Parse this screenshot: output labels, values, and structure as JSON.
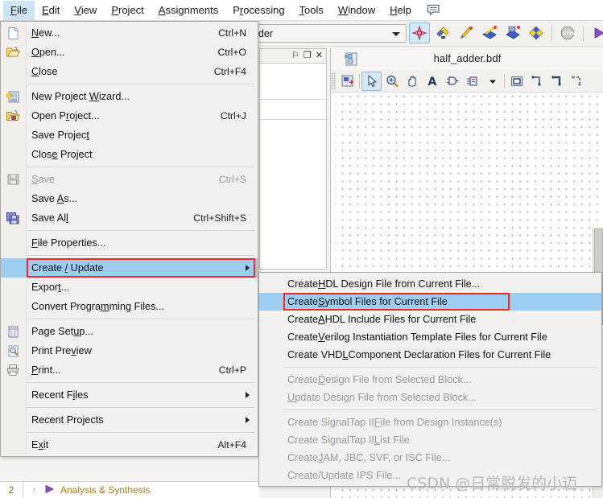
{
  "menubar": {
    "items": [
      {
        "label": "File",
        "mnemonic": "F",
        "active": true
      },
      {
        "label": "Edit",
        "mnemonic": "E",
        "active": false
      },
      {
        "label": "View",
        "mnemonic": "V",
        "active": false
      },
      {
        "label": "Project",
        "mnemonic": "P",
        "active": false
      },
      {
        "label": "Assignments",
        "mnemonic": "A",
        "active": false
      },
      {
        "label": "Processing",
        "mnemonic": "r",
        "active": false
      },
      {
        "label": "Tools",
        "mnemonic": "T",
        "active": false
      },
      {
        "label": "Window",
        "mnemonic": "W",
        "active": false
      },
      {
        "label": "Help",
        "mnemonic": "H",
        "active": false
      }
    ],
    "comment_icon": "comment-icon"
  },
  "toolbar": {
    "combo_value": "adder",
    "buttons": [
      {
        "name": "compilation-report-icon",
        "selected": true
      },
      {
        "name": "analysis-elaboration-icon",
        "selected": false
      },
      {
        "name": "analysis-synthesis-icon",
        "selected": false
      },
      {
        "name": "start-compilation-icon",
        "selected": false
      },
      {
        "name": "start-compilation-timing-icon",
        "selected": false
      },
      {
        "name": "programmer-icon",
        "selected": false
      },
      {
        "name": "stop-icon",
        "selected": false
      },
      {
        "name": "start-icon",
        "selected": false
      }
    ]
  },
  "left_dock": {
    "pin_glyph": "⚐",
    "restore_glyph": "❐",
    "close_glyph": "✕"
  },
  "editor": {
    "tab_title": "half_adder.bdf",
    "tab_icon": "bdf-file-icon",
    "tools": [
      {
        "name": "new-symbol-icon",
        "selected": false
      },
      {
        "name": "selection-tool-icon",
        "selected": true
      },
      {
        "name": "zoom-tool-icon",
        "selected": false
      },
      {
        "name": "hand-tool-icon",
        "selected": false
      },
      {
        "name": "text-tool-icon",
        "selected": false
      },
      {
        "name": "symbol-tool-icon",
        "selected": false
      },
      {
        "name": "block-tool-icon",
        "selected": false
      },
      {
        "name": "dropdown-arrow-icon",
        "selected": false
      },
      {
        "name": "rectangle-tool-icon",
        "selected": false
      },
      {
        "name": "orthogonal-node-tool-icon",
        "selected": false
      },
      {
        "name": "orthogonal-bus-tool-icon",
        "selected": false
      },
      {
        "name": "orthogonal-conduit-tool-icon",
        "selected": false
      }
    ]
  },
  "file_menu": {
    "groups": [
      [
        {
          "label": "New...",
          "mnemonic": "N",
          "accel": "Ctrl+N",
          "icon": "new-file-icon",
          "disabled": false
        },
        {
          "label": "Open...",
          "mnemonic": "O",
          "accel": "Ctrl+O",
          "icon": "open-folder-icon",
          "disabled": false
        },
        {
          "label": "Close",
          "mnemonic": "C",
          "accel": "Ctrl+F4",
          "icon": "",
          "disabled": false
        }
      ],
      [
        {
          "label": "New Project Wizard...",
          "mnemonic": "W",
          "accel": "",
          "icon": "new-project-wizard-icon",
          "disabled": false
        },
        {
          "label": "Open Project...",
          "mnemonic": "r",
          "accel": "Ctrl+J",
          "icon": "open-project-icon",
          "disabled": false
        },
        {
          "label": "Save Project",
          "mnemonic": "t",
          "accel": "",
          "icon": "",
          "disabled": false
        },
        {
          "label": "Close Project",
          "mnemonic": "e",
          "accel": "",
          "icon": "",
          "disabled": false
        }
      ],
      [
        {
          "label": "Save",
          "mnemonic": "S",
          "accel": "Ctrl+S",
          "icon": "save-icon",
          "disabled": true
        },
        {
          "label": "Save As...",
          "mnemonic": "A",
          "accel": "",
          "icon": "",
          "disabled": false
        },
        {
          "label": "Save All",
          "mnemonic": "l",
          "accel": "Ctrl+Shift+S",
          "icon": "save-all-icon",
          "disabled": false
        }
      ],
      [
        {
          "label": "File Properties...",
          "mnemonic": "F",
          "accel": "",
          "icon": "",
          "disabled": false
        }
      ],
      [
        {
          "label": "Create / Update",
          "mnemonic": "/",
          "accel": "",
          "icon": "",
          "disabled": false,
          "submenu": true,
          "highlighted": true,
          "red_box": true
        },
        {
          "label": "Export...",
          "mnemonic": "t",
          "accel": "",
          "icon": "",
          "disabled": false
        },
        {
          "label": "Convert Programming Files...",
          "mnemonic": "m",
          "accel": "",
          "icon": "",
          "disabled": false
        }
      ],
      [
        {
          "label": "Page Setup...",
          "mnemonic": "u",
          "accel": "",
          "icon": "page-setup-icon",
          "disabled": false
        },
        {
          "label": "Print Preview",
          "mnemonic": "v",
          "accel": "",
          "icon": "print-preview-icon",
          "disabled": false
        },
        {
          "label": "Print...",
          "mnemonic": "P",
          "accel": "Ctrl+P",
          "icon": "print-icon",
          "disabled": false
        }
      ],
      [
        {
          "label": "Recent Files",
          "mnemonic": "i",
          "accel": "",
          "icon": "",
          "disabled": false,
          "submenu": true
        }
      ],
      [
        {
          "label": "Recent Projects",
          "mnemonic": "j",
          "accel": "",
          "icon": "",
          "disabled": false,
          "submenu": true
        }
      ],
      [
        {
          "label": "Exit",
          "mnemonic": "x",
          "accel": "Alt+F4",
          "icon": "",
          "disabled": false
        }
      ]
    ]
  },
  "create_update_submenu": {
    "groups": [
      [
        {
          "label": "Create HDL Design File from Current File...",
          "mnemonic": "H",
          "disabled": false
        },
        {
          "label": "Create Symbol Files for Current File",
          "mnemonic": "S",
          "disabled": false,
          "highlighted": true,
          "red_box": true
        },
        {
          "label": "Create AHDL Include Files for Current File",
          "mnemonic": "A",
          "disabled": false
        },
        {
          "label": "Create Verilog Instantiation Template Files for Current File",
          "mnemonic": "V",
          "disabled": false
        },
        {
          "label": "Create VHDL Component Declaration Files for Current File",
          "mnemonic": "L",
          "disabled": false
        }
      ],
      [
        {
          "label": "Create Design File from Selected Block...",
          "mnemonic": "D",
          "disabled": true
        },
        {
          "label": "Update Design File from Selected Block...",
          "mnemonic": "U",
          "disabled": true
        }
      ],
      [
        {
          "label": "Create SignalTap II File from Design Instance(s)",
          "mnemonic": "F",
          "disabled": true
        },
        {
          "label": "Create SignalTap II List File",
          "mnemonic": "L",
          "disabled": true
        },
        {
          "label": "Create JAM, JBC, SVF, or ISC File...",
          "mnemonic": "J",
          "disabled": true
        },
        {
          "label": "Create/Update IPS File...",
          "mnemonic": "",
          "disabled": true
        }
      ]
    ]
  },
  "background_tree": {
    "number": "2",
    "chevron": "›",
    "label": "Analysis & Synthesis"
  },
  "watermark": {
    "text": "CSDN @日常脱发的小迈"
  },
  "colors": {
    "menu_bg": "#f2f1ef",
    "highlight": "#9ecdf2",
    "red_box": "#ee2a24",
    "disabled_text": "#9c9a95",
    "accent_blue": "#3b5ea8"
  }
}
